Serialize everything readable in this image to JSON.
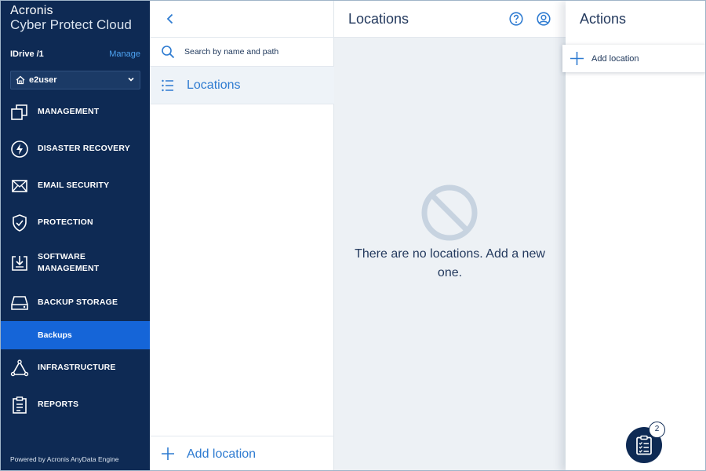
{
  "brand": {
    "line1": "Acronis",
    "line2": "Cyber Protect Cloud"
  },
  "tenant": {
    "name": "IDrive /1",
    "manage_label": "Manage"
  },
  "user_selector": {
    "value": "e2user"
  },
  "sidebar": {
    "items": [
      {
        "label": "MANAGEMENT",
        "icon": "management-icon"
      },
      {
        "label": "DISASTER RECOVERY",
        "icon": "lightning-icon"
      },
      {
        "label": "EMAIL SECURITY",
        "icon": "envelope-icon"
      },
      {
        "label": "PROTECTION",
        "icon": "shield-check-icon"
      },
      {
        "label_line1": "SOFTWARE",
        "label_line2": "MANAGEMENT",
        "icon": "software-download-icon"
      },
      {
        "label": "BACKUP STORAGE",
        "icon": "storage-drive-icon"
      },
      {
        "label": "INFRASTRUCTURE",
        "icon": "triangle-nodes-icon"
      },
      {
        "label": "REPORTS",
        "icon": "report-clipboard-icon"
      }
    ],
    "active_sub_item": {
      "label": "Backups"
    },
    "footer": "Powered by Acronis AnyData Engine"
  },
  "panel": {
    "search_placeholder": "Search by name and path",
    "list_item": {
      "label": "Locations"
    },
    "footer_button": "Add location"
  },
  "main": {
    "title": "Locations",
    "empty_message": "There are no locations. Add a new one."
  },
  "actions": {
    "title": "Actions",
    "items": [
      {
        "label": "Add location"
      }
    ]
  },
  "fab": {
    "badge_count": "2"
  },
  "colors": {
    "sidebar_bg": "#0e2a54",
    "active_item": "#1565d8",
    "accent_link": "#2e7bd1",
    "main_bg": "#edf1f5"
  }
}
